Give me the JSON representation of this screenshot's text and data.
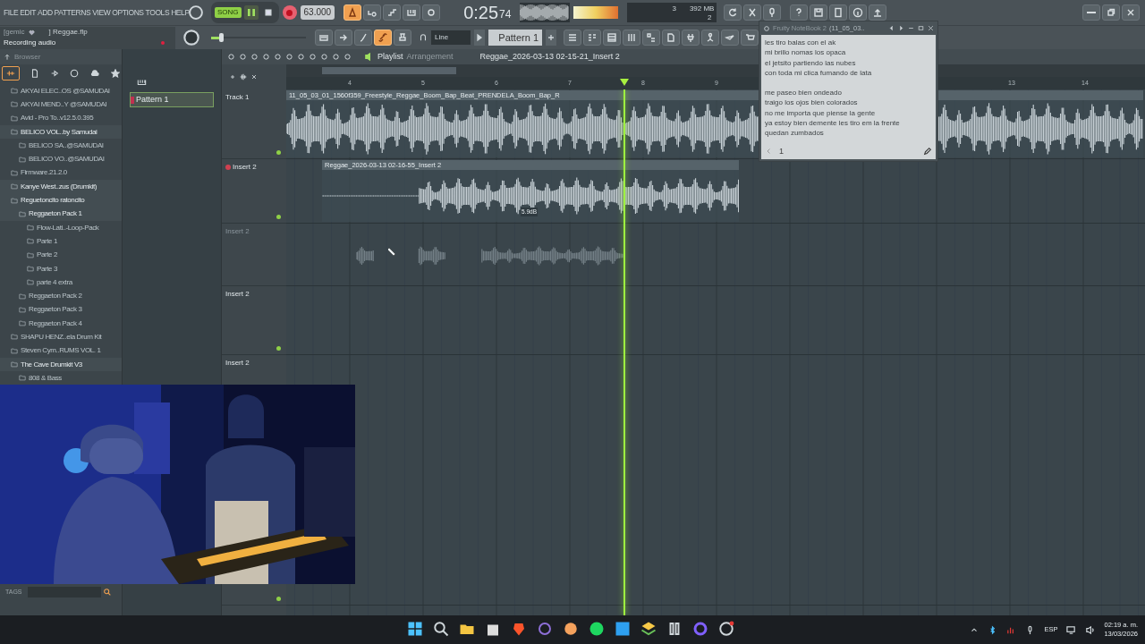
{
  "menu": [
    "FILE",
    "EDIT",
    "ADD",
    "PATTERNS",
    "VIEW",
    "OPTIONS",
    "TOOLS",
    "HELP"
  ],
  "transport": {
    "mode": "SONG",
    "song_selected": true,
    "playing": true,
    "recording": true,
    "tempo": "63.000",
    "metronome_on": true
  },
  "clock": {
    "time": "0:25",
    "centis": "74"
  },
  "cpu": {
    "value_1": "3",
    "memory": "392 MB",
    "value_2": "2"
  },
  "hint": {
    "prefix": "[gemic",
    "file": "] Reggae.flp",
    "message": "Recording audio"
  },
  "master_pitch": {
    "level": 0.1
  },
  "tools": {
    "link_on": true,
    "snap": "Line",
    "pattern": "Pattern 1"
  },
  "browser": {
    "title": "Browser",
    "tags_label": "TAGS",
    "tree": [
      {
        "label": "AKYAI ELEC..OS @SAMUDAI",
        "expanded": false
      },
      {
        "label": "AKYAI MEND..Y @SAMUDAI",
        "expanded": false
      },
      {
        "label": "Avid - Pro To..v12.5.0.395",
        "expanded": false
      },
      {
        "label": "BELICO VOL..by Samudai",
        "expanded": true,
        "children": [
          {
            "label": "BELICO SA..@SAMUDAI",
            "expanded": false
          },
          {
            "label": "BELICO VO..@SAMUDAI",
            "expanded": false
          }
        ]
      },
      {
        "label": "Firmware.21.2.0",
        "expanded": false
      },
      {
        "label": "Kanye West..zus (Drumkit)",
        "expanded": true
      },
      {
        "label": "Reguetoncito ratoncito",
        "expanded": true,
        "children": [
          {
            "label": "Reggaeton Pack 1",
            "expanded": true,
            "children": [
              {
                "label": "Flow-Lati..-Loop-Pack",
                "expanded": false
              },
              {
                "label": "Parte 1",
                "expanded": false
              },
              {
                "label": "Parte 2",
                "expanded": false
              },
              {
                "label": "Parte 3",
                "expanded": false
              },
              {
                "label": "parte 4 extra",
                "expanded": false
              }
            ]
          },
          {
            "label": "Reggaeton Pack 2",
            "expanded": false
          },
          {
            "label": "Reggaeton Pack 3",
            "expanded": false
          },
          {
            "label": "Reggaeton Pack 4",
            "expanded": false
          }
        ]
      },
      {
        "label": "SHAPU HENZ..ela Drum Kit",
        "expanded": false
      },
      {
        "label": "Steven Cym..RUMS VOL. 1",
        "expanded": false
      },
      {
        "label": "The Cave Drumkit V3",
        "expanded": true,
        "children": [
          {
            "label": "808 & Bass",
            "expanded": false
          }
        ]
      }
    ]
  },
  "patterns": [
    {
      "label": "Pattern 1",
      "selected": true
    }
  ],
  "playlist": {
    "title": "Playlist",
    "subtitle": "Arrangement",
    "clip_title": "Reggae_2026-03-13 02-15-21_Insert 2",
    "ruler": [
      "4",
      "5",
      "6",
      "7",
      "8",
      "9",
      "13",
      "14"
    ],
    "playhead": {
      "level": 0.395
    },
    "tracks": [
      {
        "name": "Track 1",
        "disabled": false,
        "armed": false,
        "clip": {
          "kind": "audio",
          "name": "11_05_03_01_1560f359_Freestyle_Reggae_Boom_Bap_Beat_PRENDELA_Boom_Bap_R"
        }
      },
      {
        "name": "Insert 2",
        "disabled": false,
        "armed": true,
        "clip": {
          "kind": "audio",
          "name": "Reggae_2026-03-13 02-16-55_Insert 2",
          "gain": "5.9dB"
        }
      },
      {
        "name": "Insert 2",
        "disabled": true,
        "armed": false,
        "clip": {
          "kind": "ghost"
        }
      },
      {
        "name": "Insert 2",
        "disabled": false,
        "armed": false
      },
      {
        "name": "Insert 2",
        "disabled": false,
        "armed": false
      }
    ]
  },
  "notebook": {
    "title": "Fruity NoteBook 2",
    "title_extra": "(11_05_03..",
    "paragraphs": [
      [
        "les tiro balas con el ak",
        "mi brillo nomas los opaca",
        "el jetsito partiendo las nubes",
        "con toda mi clica fumando de lata"
      ],
      [
        "me paseo bien ondeado",
        "traigo los ojos bien colorados",
        "no me importa que piense la gente",
        "ya estoy bien demente les tiro em la frente",
        "quedan zumbados"
      ]
    ],
    "page": "1"
  },
  "tray": {
    "language": "ESP",
    "time": "02:19 a. m.",
    "date": "13/03/2026"
  }
}
